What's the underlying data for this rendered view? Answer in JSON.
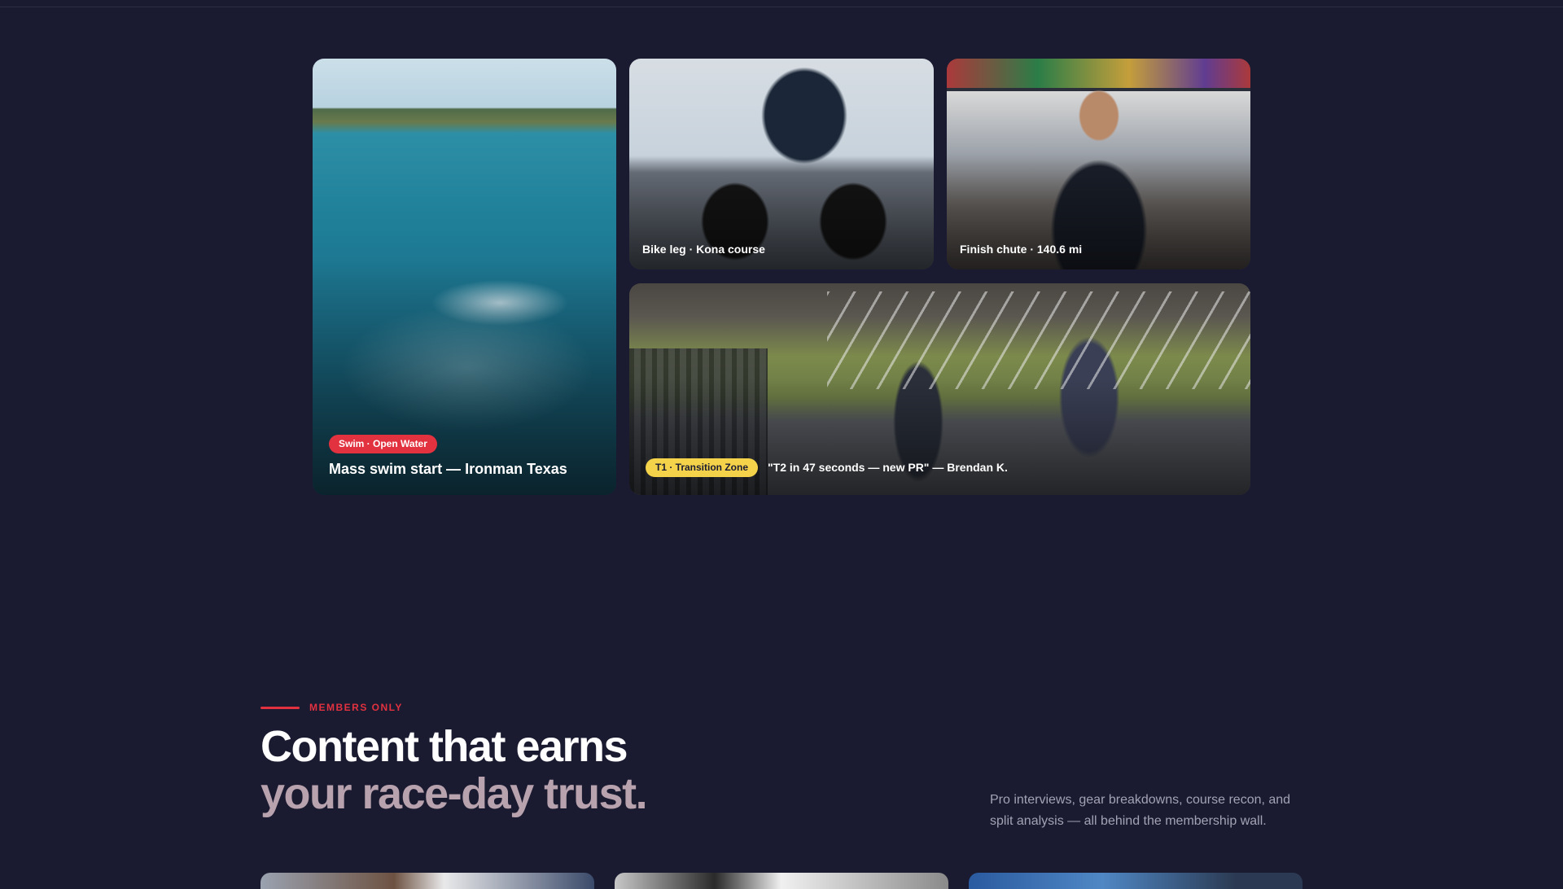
{
  "gallery": {
    "swim": {
      "badge": "Swim · Open Water",
      "title": "Mass swim start — Ironman Texas"
    },
    "bike": {
      "caption": "Bike leg · Kona course"
    },
    "finish": {
      "caption": "Finish chute · 140.6 mi"
    },
    "transition": {
      "badge": "T1 · Transition Zone",
      "quote": "\"T2 in 47 seconds — new PR\" — Brendan K."
    }
  },
  "members": {
    "eyebrow": "MEMBERS ONLY",
    "heading_line1": "Content that earns",
    "heading_line2": "your race-day trust.",
    "blurb": "Pro interviews, gear breakdowns, course recon, and split analysis — all behind the membership wall."
  },
  "colors": {
    "background": "#1a1a31",
    "accent_red": "#e2323f",
    "accent_yellow": "#f4d34a",
    "muted_heading": "#b7a2ad"
  }
}
